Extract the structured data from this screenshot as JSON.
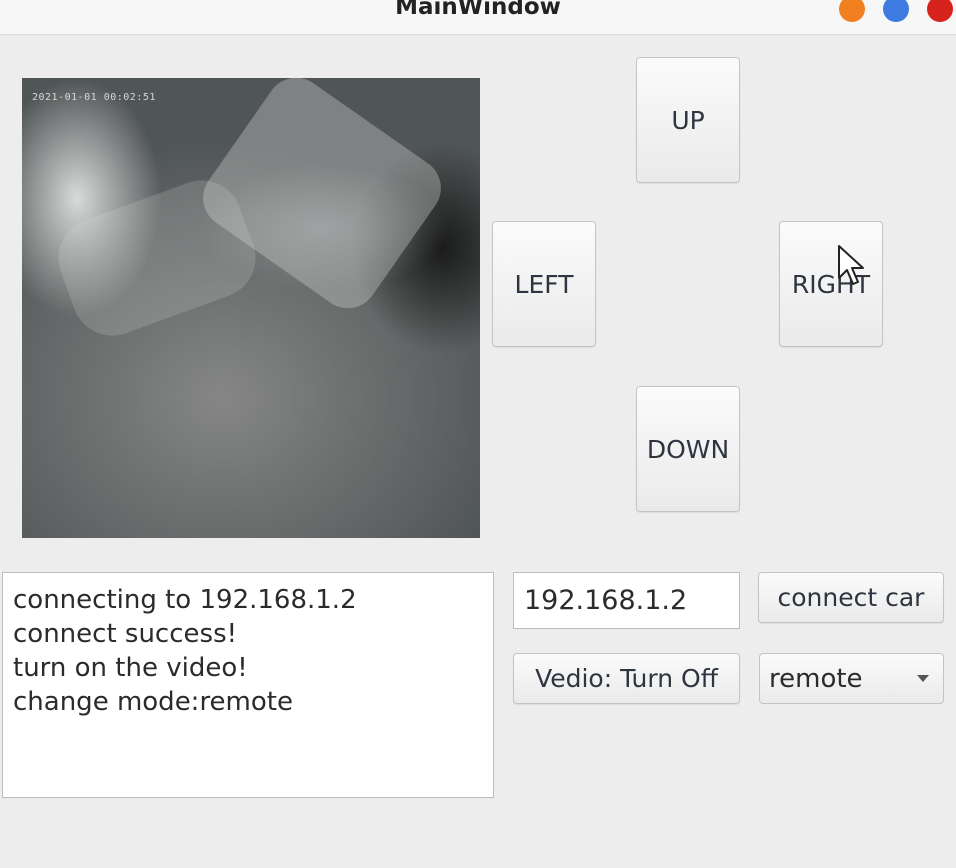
{
  "window": {
    "title": "MainWindow",
    "controls": {
      "minimize_color": "#f07f1f",
      "maximize_color": "#3d7be0",
      "close_color": "#d8221c"
    }
  },
  "video": {
    "overlay_timestamp": "2021-01-01 00:02:51"
  },
  "direction_pad": {
    "up_label": "UP",
    "left_label": "LEFT",
    "right_label": "RIGHT",
    "down_label": "DOWN"
  },
  "log": {
    "lines": [
      "connecting to 192.168.1.2",
      "connect success!",
      "turn on the video!",
      "change mode:remote"
    ]
  },
  "connection": {
    "ip_value": "192.168.1.2",
    "connect_label": "connect car"
  },
  "video_toggle": {
    "label": "Vedio: Turn Off"
  },
  "mode_select": {
    "selected": "remote",
    "icon": "chevron-down-icon"
  }
}
